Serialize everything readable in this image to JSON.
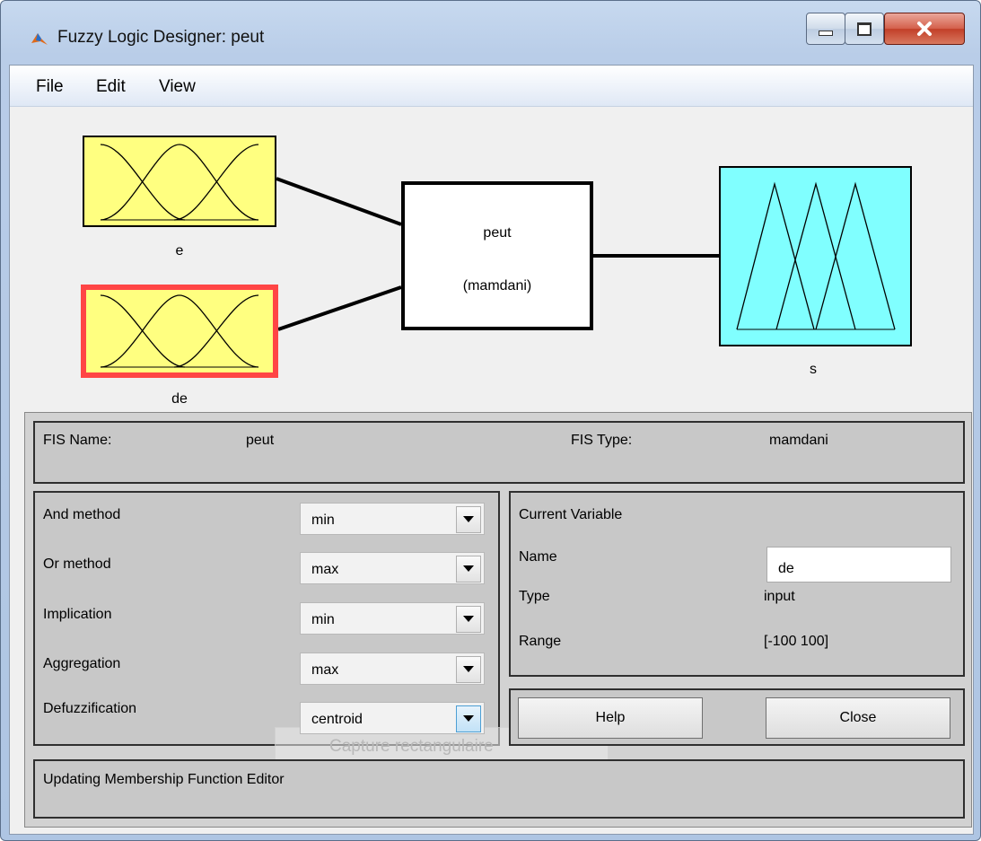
{
  "window": {
    "title": "Fuzzy Logic Designer: peut",
    "controls": [
      "minimize-icon",
      "maximize-icon",
      "close-icon"
    ]
  },
  "menu": {
    "file": "File",
    "edit": "Edit",
    "view": "View"
  },
  "diagram": {
    "inputs": [
      {
        "name": "e",
        "selected": false
      },
      {
        "name": "de",
        "selected": true
      }
    ],
    "output": {
      "name": "s"
    },
    "system": {
      "name": "peut",
      "type": "(mamdani)"
    },
    "colors": {
      "input_fill": "#ffff80",
      "output_fill": "#80ffff",
      "selected_border": "#ff4545"
    }
  },
  "fis": {
    "name_label": "FIS Name:",
    "name_value": "peut",
    "type_label": "FIS Type:",
    "type_value": "mamdani"
  },
  "methods": [
    {
      "label": "And method",
      "value": "min"
    },
    {
      "label": "Or method",
      "value": "max"
    },
    {
      "label": "Implication",
      "value": "min"
    },
    {
      "label": "Aggregation",
      "value": "max"
    },
    {
      "label": "Defuzzification",
      "value": "centroid"
    }
  ],
  "current_variable": {
    "title": "Current Variable",
    "name_label": "Name",
    "name_value": "de",
    "type_label": "Type",
    "type_value": "input",
    "range_label": "Range",
    "range_value": "[-100 100]"
  },
  "buttons": {
    "help": "Help",
    "close": "Close"
  },
  "status": "Updating Membership Function Editor",
  "overlay_tooltip": "Capture rectangulaire"
}
